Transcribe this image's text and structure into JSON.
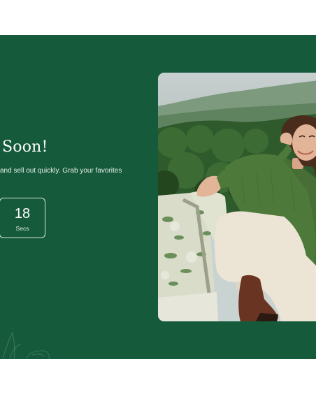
{
  "promo": {
    "headline": "Soon!",
    "subtext": "and sell out quickly. Grab your favorites",
    "countdown": {
      "value": "18",
      "unit": "Secs"
    }
  },
  "colors": {
    "banner_bg": "#155a3b",
    "text": "#ffffff",
    "sweater": "#4d7a3a",
    "pants": "#ece4d4",
    "boot": "#6a3422"
  },
  "image": {
    "subject": "woman-in-green-sweater-on-sofa-outdoors"
  }
}
